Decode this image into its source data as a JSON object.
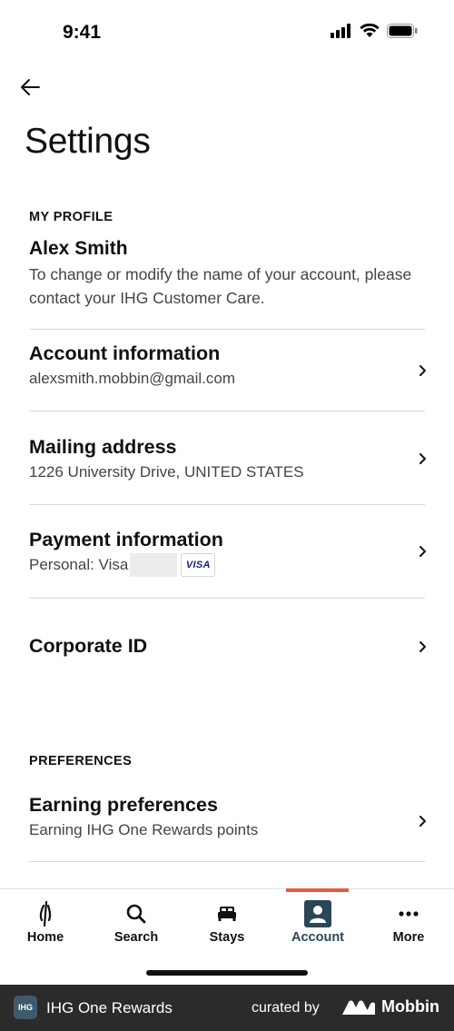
{
  "status_bar": {
    "time": "9:41"
  },
  "page": {
    "title": "Settings"
  },
  "my_profile": {
    "section_label": "MY PROFILE",
    "name": "Alex Smith",
    "description": "To change or modify the name of your account, please contact your IHG Customer Care."
  },
  "rows": [
    {
      "title": "Account information",
      "subtitle": "alexsmith.mobbin@gmail.com"
    },
    {
      "title": "Mailing address",
      "subtitle": "1226 University Drive, UNITED STATES"
    },
    {
      "title": "Payment information",
      "subtitle": "Personal: Visa",
      "card_brand": "VISA"
    },
    {
      "title": "Corporate ID"
    }
  ],
  "preferences": {
    "section_label": "PREFERENCES",
    "rows": [
      {
        "title": "Earning preferences",
        "subtitle": "Earning IHG One Rewards points"
      }
    ]
  },
  "tab_bar": {
    "tabs": [
      {
        "label": "Home",
        "icon": "ihg-logo-icon"
      },
      {
        "label": "Search",
        "icon": "search-icon"
      },
      {
        "label": "Stays",
        "icon": "bed-icon"
      },
      {
        "label": "Account",
        "icon": "account-icon",
        "active": true
      },
      {
        "label": "More",
        "icon": "more-dots-icon"
      }
    ],
    "active_color": "#2a4758",
    "indicator_color": "#e4593f"
  },
  "footer": {
    "logo_text": "IHG",
    "app_name": "IHG One Rewards",
    "curated_by": "curated by",
    "brand": "Mobbin"
  }
}
